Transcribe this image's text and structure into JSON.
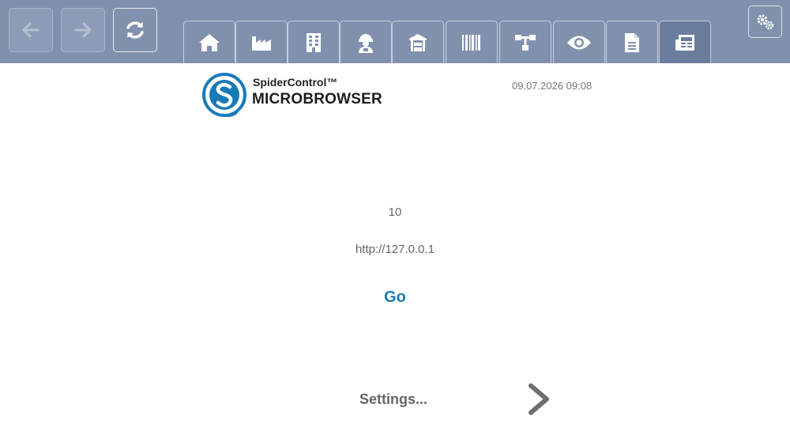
{
  "toolbar": {
    "back_icon": "arrow-left-icon",
    "forward_icon": "arrow-right-icon",
    "reload_icon": "refresh-icon",
    "settings_icon": "gears-icon",
    "tabs": [
      {
        "icon": "home-icon",
        "active": false
      },
      {
        "icon": "factory-icon",
        "active": false
      },
      {
        "icon": "building-icon",
        "active": false
      },
      {
        "icon": "operator-icon",
        "active": false
      },
      {
        "icon": "warehouse-icon",
        "active": false
      },
      {
        "icon": "barcode-icon",
        "active": false
      },
      {
        "icon": "network-icon",
        "active": false
      },
      {
        "icon": "eye-icon",
        "active": false
      },
      {
        "icon": "document-icon",
        "active": false
      },
      {
        "icon": "newspaper-icon",
        "active": true
      }
    ],
    "colors": {
      "bar": "#8191ad",
      "active_tab": "#6b7d9d"
    }
  },
  "header": {
    "brand_line1": "SpiderControl™",
    "brand_line2": "MICROBROWSER",
    "datetime": "09.07.2026 09:08",
    "logo_color": "#1a7ab8"
  },
  "main": {
    "value": "10",
    "url": "http://127.0.0.1",
    "go_label": "Go",
    "go_color": "#1a7ab8"
  },
  "footer": {
    "settings_label": "Settings...",
    "next_icon": "chevron-right-icon"
  }
}
